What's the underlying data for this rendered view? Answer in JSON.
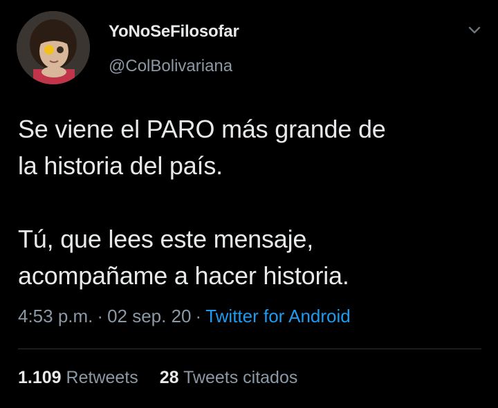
{
  "author": {
    "display_name": "YoNoSeFilosofar",
    "handle": "@ColBolivariana",
    "avatar_icon": "profile-photo"
  },
  "tweet": {
    "text": "Se viene el PARO más grande de\nla historia del país.\n\nTú, que lees este mensaje,\nacompañame a hacer historia."
  },
  "meta": {
    "time": "4:53 p.m.",
    "separator": "·",
    "date": "02 sep. 20",
    "source": "Twitter for Android"
  },
  "stats": {
    "retweets_count": "1.109",
    "retweets_label": "Retweets",
    "quotes_count": "28",
    "quotes_label": "Tweets citados"
  },
  "colors": {
    "background": "#000000",
    "primary_text": "#e7e9ea",
    "secondary_text": "#8b98a5",
    "link": "#1d9bf0"
  },
  "icons": {
    "menu": "chevron-down-icon"
  }
}
